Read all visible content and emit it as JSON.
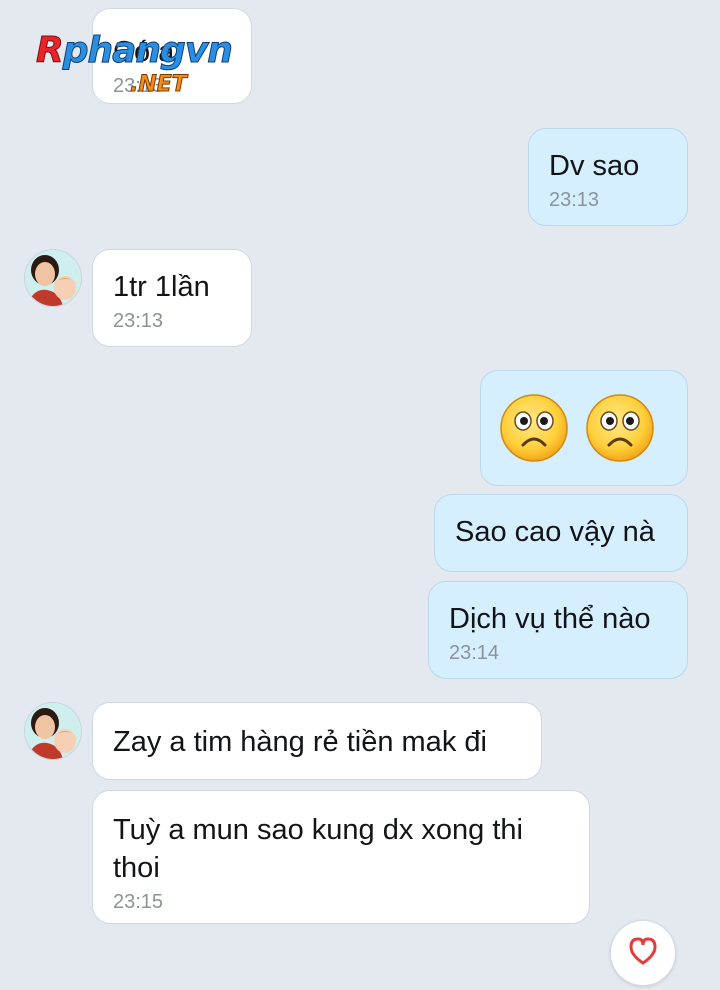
{
  "messages": [
    {
      "text": "Có a",
      "time": "23:13"
    },
    {
      "text": "Dv sao",
      "time": "23:13"
    },
    {
      "text": "1tr 1lần",
      "time": "23:13"
    },
    {
      "emoji": [
        "frowning-face",
        "frowning-face"
      ]
    },
    {
      "text": "Sao cao vậy nà"
    },
    {
      "text": "Dịch vụ thể nào",
      "time": "23:14"
    },
    {
      "text": "Zay a tim hàng rẻ tiền mak đi"
    },
    {
      "text": "Tuỳ a mun sao kung dx xong thi\nthoi",
      "time": "23:15"
    }
  ],
  "watermark": {
    "part1": "R",
    "part2": "phangvn",
    "part3": ".NET"
  },
  "colors": {
    "background": "#e4e9f0",
    "incoming": "#ffffff",
    "outgoing": "#d6efff"
  }
}
